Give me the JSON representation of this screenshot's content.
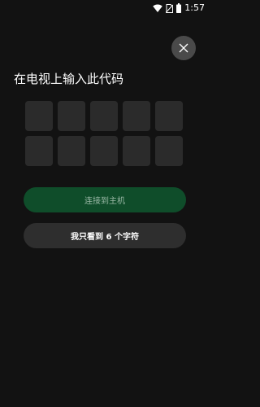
{
  "status_bar": {
    "time": "1:57",
    "icons": [
      "wifi-icon",
      "no-sim-icon",
      "battery-icon"
    ]
  },
  "close_button": {
    "icon": "close-icon"
  },
  "title": "在电视上输入此代码",
  "code_boxes": [
    "",
    "",
    "",
    "",
    "",
    "",
    "",
    "",
    "",
    ""
  ],
  "connect_button": {
    "label": "连接到主机"
  },
  "six_chars_button": {
    "label": "我只看到 6 个字符"
  },
  "colors": {
    "background": "#121212",
    "connect_button_bg": "#0f4d2a",
    "secondary_button_bg": "#2e2e2e",
    "code_box_bg": "#2b2b2b"
  }
}
